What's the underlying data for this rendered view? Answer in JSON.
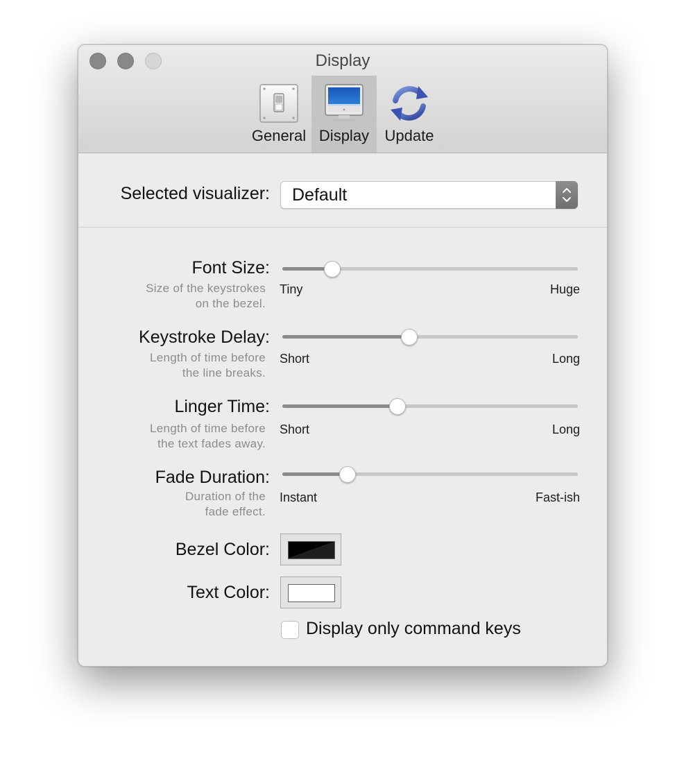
{
  "window": {
    "title": "Display"
  },
  "toolbar": {
    "tabs": [
      {
        "label": "General",
        "icon": "general-switch-icon",
        "selected": false
      },
      {
        "label": "Display",
        "icon": "display-monitor-icon",
        "selected": true
      },
      {
        "label": "Update",
        "icon": "update-arrows-icon",
        "selected": false
      }
    ]
  },
  "visualizer": {
    "label": "Selected visualizer:",
    "value": "Default"
  },
  "settings": {
    "font_size": {
      "label": "Font Size:",
      "desc_line1": "Size of the keystrokes",
      "desc_line2": "on the bezel.",
      "min_label": "Tiny",
      "max_label": "Huge",
      "value": 0.17
    },
    "keystroke_delay": {
      "label": "Keystroke Delay:",
      "desc_line1": "Length of time before",
      "desc_line2": "the line breaks.",
      "min_label": "Short",
      "max_label": "Long",
      "value": 0.43
    },
    "linger_time": {
      "label": "Linger Time:",
      "desc_line1": "Length of time before",
      "desc_line2": "the text fades away.",
      "min_label": "Short",
      "max_label": "Long",
      "value": 0.39
    },
    "fade_duration": {
      "label": "Fade Duration:",
      "desc_line1": "Duration of the",
      "desc_line2": "fade effect.",
      "min_label": "Instant",
      "max_label": "Fast-ish",
      "value": 0.22
    },
    "bezel_color": {
      "label": "Bezel Color:",
      "color": "#000000"
    },
    "text_color": {
      "label": "Text Color:",
      "color": "#ffffff"
    },
    "command_keys_only": {
      "label": "Display only command keys",
      "checked": false
    }
  },
  "colors": {
    "window_bg": "#ececec",
    "selected_tab_bg": "#c4c4c4",
    "slider_fill": "#8b8b8b"
  }
}
